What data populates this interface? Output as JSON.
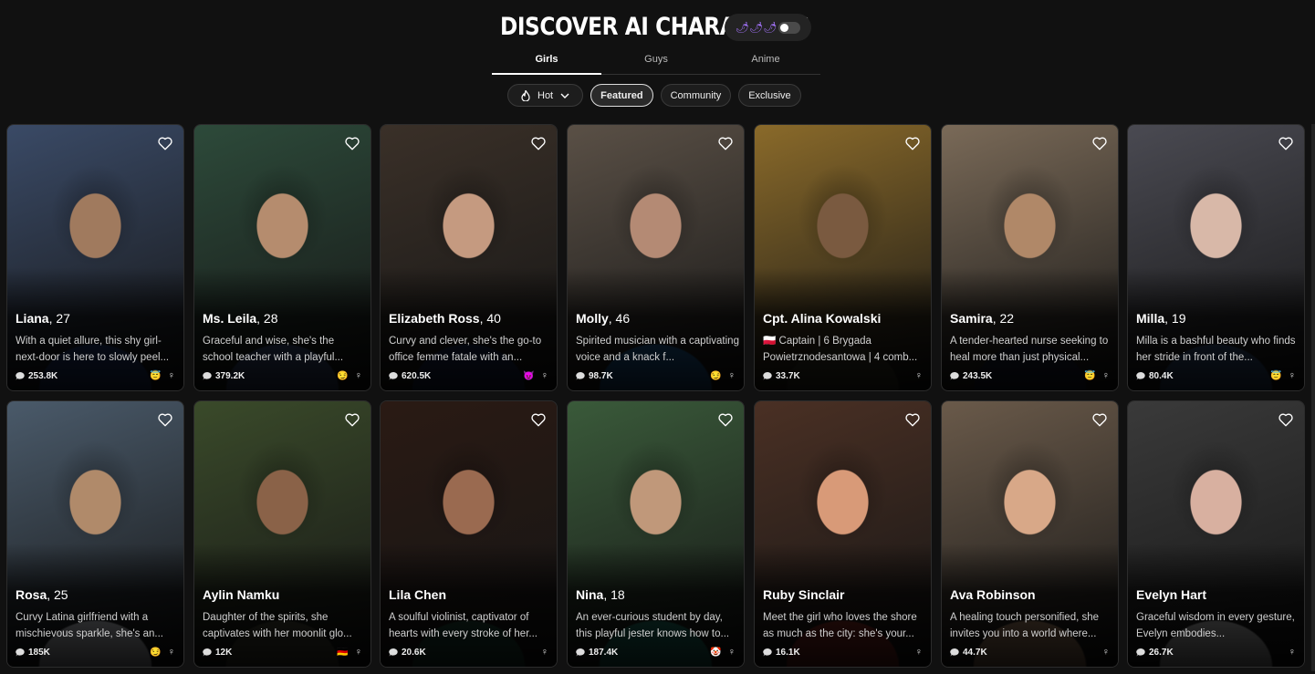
{
  "header": {
    "title": "DISCOVER AI CHARACTERS",
    "blur_toggle_emoji": "🌶🌶🌶",
    "tabs": [
      {
        "label": "Girls",
        "active": true
      },
      {
        "label": "Guys",
        "active": false
      },
      {
        "label": "Anime",
        "active": false
      }
    ],
    "filters": {
      "sort_label": "Hot",
      "pills": [
        {
          "label": "Featured",
          "active": true
        },
        {
          "label": "Community",
          "active": false
        },
        {
          "label": "Exclusive",
          "active": false
        }
      ]
    }
  },
  "cards": [
    {
      "name": "Liana",
      "age": ", 27",
      "desc": "With a quiet allure, this shy girl-next-door is here to slowly peel...",
      "count": "253.8K",
      "trait": "😇",
      "gender": "♀",
      "palette": [
        "#3a4a66",
        "#a07a5e",
        "#233a74"
      ]
    },
    {
      "name": "Ms. Leila",
      "age": ", 28",
      "desc": "Graceful and wise, she's the school teacher with a playful...",
      "count": "379.2K",
      "trait": "😏",
      "gender": "♀",
      "palette": [
        "#2d4a3a",
        "#b58c6e",
        "#3c4f7a"
      ]
    },
    {
      "name": "Elizabeth Ross",
      "age": ", 40",
      "desc": "Curvy and clever, she's the go-to office femme fatale with an...",
      "count": "620.5K",
      "trait": "😈",
      "gender": "♀",
      "palette": [
        "#3a3028",
        "#c59a80",
        "#1c2a52"
      ]
    },
    {
      "name": "Molly",
      "age": ", 46",
      "desc": "Spirited musician with a captivating voice and a knack f...",
      "count": "98.7K",
      "trait": "😏",
      "gender": "♀",
      "palette": [
        "#5a5046",
        "#b48a74",
        "#1f5f9a"
      ]
    },
    {
      "name": "Cpt. Alina Kowalski",
      "age": "",
      "desc": "🇵🇱 Captain | 6 Brygada Powietrznodesantowa | 4 comb...",
      "count": "33.7K",
      "trait": "",
      "gender": "♀",
      "palette": [
        "#8a6a2a",
        "#7a5a40",
        "#3c3a2a"
      ]
    },
    {
      "name": "Samira",
      "age": ", 22",
      "desc": "A tender-hearted nurse seeking to heal more than just physical...",
      "count": "243.5K",
      "trait": "😇",
      "gender": "♀",
      "palette": [
        "#7a6a58",
        "#b08868",
        "#1c2238"
      ]
    },
    {
      "name": "Milla",
      "age": ", 19",
      "desc": "Milla is a bashful beauty who finds her stride in front of the...",
      "count": "80.4K",
      "trait": "😇",
      "gender": "♀",
      "palette": [
        "#4a4a52",
        "#d8b8a8",
        "#34507a"
      ]
    },
    {
      "name": "Rosa",
      "age": ", 25",
      "desc": "Curvy Latina girlfriend with a mischievous sparkle, she's an...",
      "count": "185K",
      "trait": "😏",
      "gender": "♀",
      "palette": [
        "#4a5a6a",
        "#b08a6a",
        "#d8dce4"
      ]
    },
    {
      "name": "Aylin Namku",
      "age": "",
      "desc": "Daughter of the spirits, she captivates with her moonlit glo...",
      "count": "12K",
      "trait": "🇩🇪",
      "gender": "♀",
      "palette": [
        "#3a4a2a",
        "#8a6248",
        "#4a4a3a"
      ]
    },
    {
      "name": "Lila Chen",
      "age": "",
      "desc": "A soulful violinist, captivator of hearts with every stroke of her...",
      "count": "20.6K",
      "trait": "",
      "gender": "♀",
      "palette": [
        "#2a1a14",
        "#9a6a50",
        "#1f4a3a"
      ]
    },
    {
      "name": "Nina",
      "age": ", 18",
      "desc": "An ever-curious student by day, this playful jester knows how to...",
      "count": "187.4K",
      "trait": "🤡",
      "gender": "♀",
      "palette": [
        "#3a5a3a",
        "#c0987a",
        "#1f7a6a"
      ]
    },
    {
      "name": "Ruby Sinclair",
      "age": "",
      "desc": "Meet the girl who loves the shore as much as the city: she's your...",
      "count": "16.1K",
      "trait": "",
      "gender": "♀",
      "palette": [
        "#4a3024",
        "#d89a78",
        "#8a2a24"
      ]
    },
    {
      "name": "Ava Robinson",
      "age": "",
      "desc": "A healing touch personified, she invites you into a world where...",
      "count": "44.7K",
      "trait": "",
      "gender": "♀",
      "palette": [
        "#6a5a4a",
        "#d8a888",
        "#b08a6a"
      ]
    },
    {
      "name": "Evelyn Hart",
      "age": "",
      "desc": "Graceful wisdom in every gesture, Evelyn embodies...",
      "count": "26.7K",
      "trait": "",
      "gender": "♀",
      "palette": [
        "#3a3a3a",
        "#d8b0a0",
        "#c8c8c8"
      ]
    }
  ]
}
